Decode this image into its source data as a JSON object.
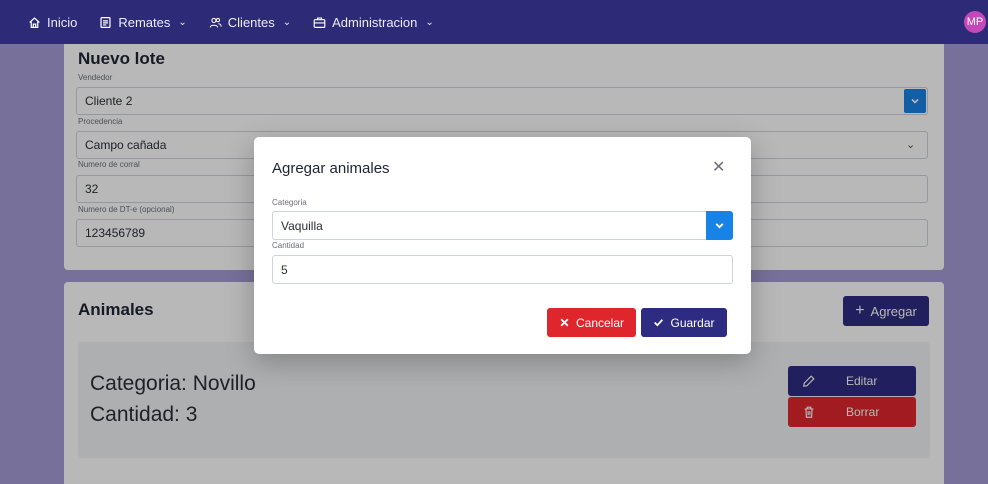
{
  "nav": {
    "items": [
      {
        "label": "Inicio",
        "icon": "home-icon"
      },
      {
        "label": "Remates",
        "icon": "document-icon"
      },
      {
        "label": "Clientes",
        "icon": "users-icon"
      },
      {
        "label": "Administracion",
        "icon": "briefcase-icon"
      }
    ],
    "avatar_initials": "MP"
  },
  "lot_form": {
    "title": "Nuevo lote",
    "vendedor_label": "Vendedor",
    "vendedor_value": "Cliente 2",
    "procedencia_label": "Procedencia",
    "procedencia_value": "Campo cañada",
    "corral_label": "Numero de corral",
    "corral_value": "32",
    "dte_label": "Numero de DT-e (opcional)",
    "dte_value": "123456789"
  },
  "animals": {
    "title": "Animales",
    "add_label": "Agregar",
    "item": {
      "category_text": "Categoria: Novillo",
      "quantity_text": "Cantidad: 3",
      "edit_label": "Editar",
      "delete_label": "Borrar"
    }
  },
  "modal": {
    "title": "Agregar animales",
    "categoria_label": "Categoria",
    "categoria_value": "Vaquilla",
    "cantidad_label": "Cantidad",
    "cantidad_value": "5",
    "cancel_label": "Cancelar",
    "save_label": "Guardar"
  },
  "colors": {
    "navbar": "#2d2a78",
    "primary": "#2e2c82",
    "danger": "#e0262d",
    "dropdown_blue": "#1883e6",
    "background": "#a59bd6"
  }
}
